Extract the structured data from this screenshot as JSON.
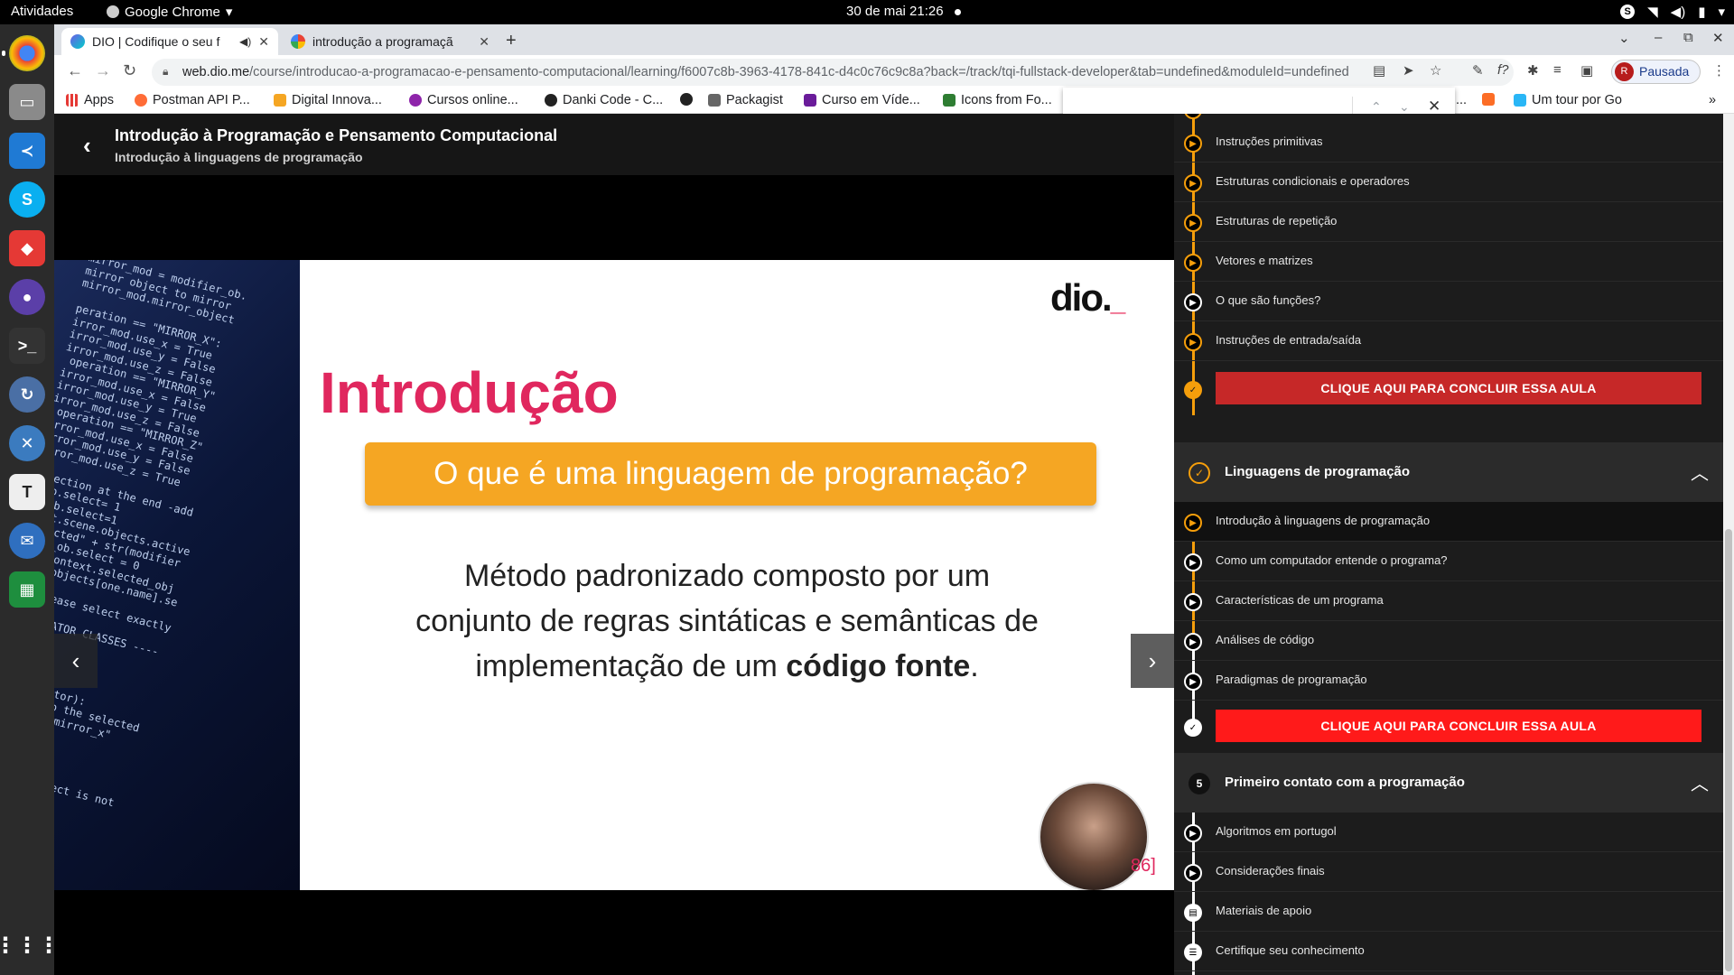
{
  "os": {
    "activities": "Atividades",
    "app_name": "Google Chrome",
    "clock": "30 de mai  21:26"
  },
  "browser": {
    "tabs": [
      {
        "title": "DIO | Codifique o seu f",
        "active": true
      },
      {
        "title": "introdução a programaçã",
        "active": false
      }
    ],
    "url_host": "web.dio.me",
    "url_path": "/course/introducao-a-programacao-e-pensamento-computacional/learning/f6007c8b-3963-4178-841c-d4c0c76c9c8a?back=/track/tqi-fullstack-developer&tab=undefined&moduleId=undefined",
    "profile_initial": "R",
    "profile_label": "Pausada",
    "bookmarks": [
      "Apps",
      "Postman API P...",
      "Digital Innova...",
      "Cursos online...",
      "Danki Code - C...",
      "Packagist",
      "Curso em Víde...",
      "Icons from Fo...",
      "...",
      "Um tour por Go"
    ]
  },
  "course": {
    "title": "Introdução à Programação e Pensamento Computacional",
    "subtitle": "Introdução à linguagens de programação"
  },
  "slide": {
    "logo": "dio.",
    "title": "Introdução",
    "question": "O que é uma linguagem de programação?",
    "body_line1": "Método padronizado composto por um",
    "body_line2": "conjunto de regras sintáticas e semânticas de",
    "body_line3_pre": "implementação de um ",
    "body_line3_bold": "código fonte",
    "body_line3_post": ".",
    "page_number": "86]"
  },
  "sidebar": {
    "prev_lessons": [
      "Instruções primitivas",
      "Estruturas condicionais e operadores",
      "Estruturas de repetição",
      "Vetores e matrizes",
      "O que são funções?",
      "Instruções de entrada/saída"
    ],
    "conclude_label": "CLIQUE AQUI PARA CONCLUIR ESSA AULA",
    "module4": {
      "title": "Linguagens de programação",
      "lessons": [
        "Introdução à linguagens de programação",
        "Como um computador entende o programa?",
        "Características de um programa",
        "Análises de código",
        "Paradigmas de programação"
      ]
    },
    "module5": {
      "number": "5",
      "title": "Primeiro contato com a programação",
      "lessons": [
        "Algoritmos em portugol",
        "Considerações finais",
        "Materiais de apoio",
        "Certifique seu conhecimento"
      ]
    }
  },
  "colors": {
    "accent_orange": "#f59e0b",
    "conclude_dark": "#c62828",
    "conclude_bright": "#ff1a1a",
    "slide_pink": "#e0275e"
  }
}
